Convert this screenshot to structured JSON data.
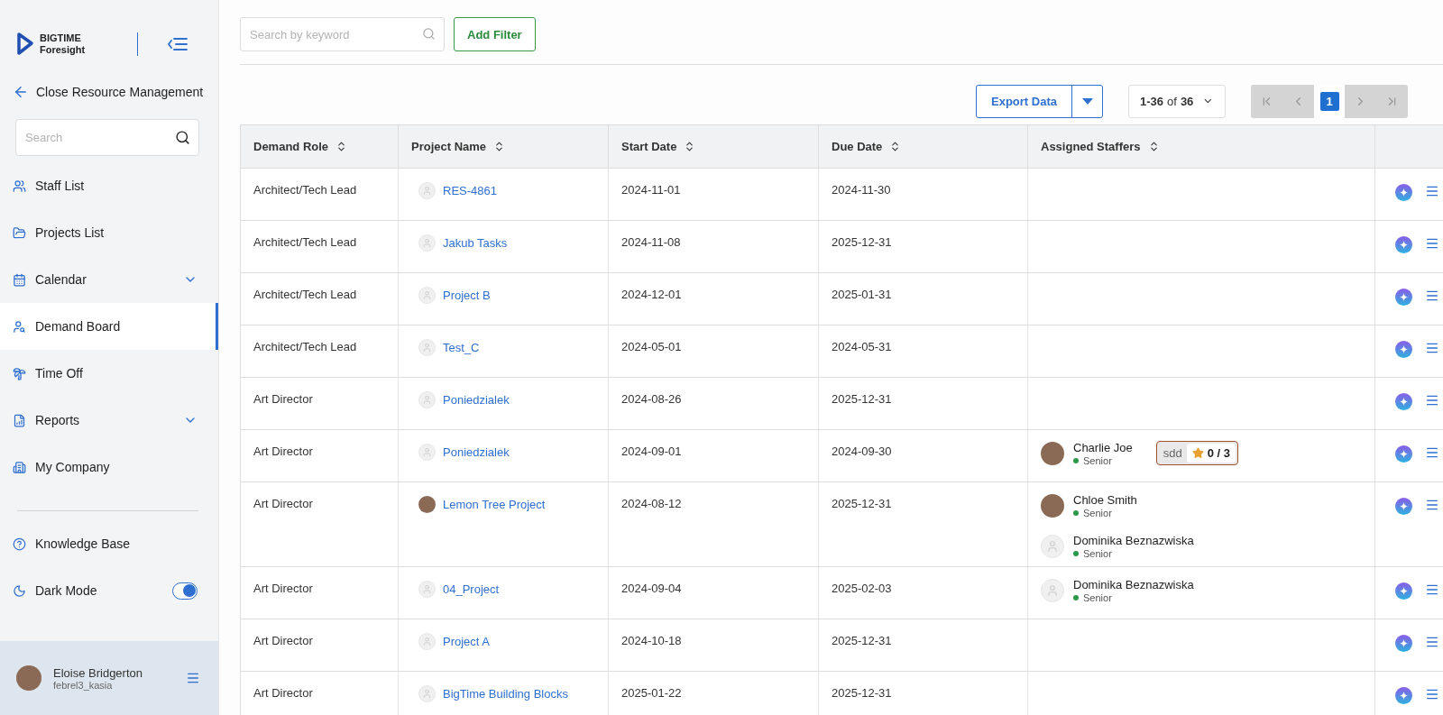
{
  "sidebar": {
    "logo": {
      "line1": "BIGTIME",
      "line2": "Foresight"
    },
    "back_link": "Close Resource Management",
    "search": {
      "placeholder": "Search"
    },
    "items": [
      {
        "label": "Staff List",
        "selected": false
      },
      {
        "label": "Projects List",
        "selected": false
      },
      {
        "label": "Calendar",
        "selected": false,
        "expandable": true
      },
      {
        "label": "Demand Board",
        "selected": true
      },
      {
        "label": "Time Off",
        "selected": false
      },
      {
        "label": "Reports",
        "selected": false,
        "expandable": true
      },
      {
        "label": "My Company",
        "selected": false
      }
    ],
    "help": "Knowledge Base",
    "dark_mode": {
      "label": "Dark Mode",
      "on": true
    },
    "user": {
      "name": "Eloise Bridgerton",
      "username": "febrel3_kasia"
    }
  },
  "toolbar": {
    "search": {
      "placeholder": "Search by keyword"
    },
    "filter_button": "Add Filter",
    "export_button": "Export Data",
    "range": {
      "from_to": "1-36",
      "of": "of",
      "total": "36"
    },
    "pages": [
      {
        "label": "1",
        "selected": true
      }
    ]
  },
  "table": {
    "columns": [
      "Demand Role",
      "Project Name",
      "Start Date",
      "Due Date",
      "Assigned Staffers"
    ],
    "rows": [
      {
        "role": "Architect/Tech Lead",
        "project": {
          "name": "RES-4861",
          "photo": false
        },
        "start": "2024-11-01",
        "due": "2024-11-30",
        "staffers": []
      },
      {
        "role": "Architect/Tech Lead",
        "project": {
          "name": "Jakub Tasks",
          "photo": false
        },
        "start": "2024-11-08",
        "due": "2025-12-31",
        "staffers": []
      },
      {
        "role": "Architect/Tech Lead",
        "project": {
          "name": "Project B",
          "photo": false
        },
        "start": "2024-12-01",
        "due": "2025-01-31",
        "staffers": []
      },
      {
        "role": "Architect/Tech Lead",
        "project": {
          "name": "Test_C",
          "photo": false
        },
        "start": "2024-05-01",
        "due": "2024-05-31",
        "staffers": []
      },
      {
        "role": "Art Director",
        "project": {
          "name": "Poniedzialek",
          "photo": false
        },
        "start": "2024-08-26",
        "due": "2025-12-31",
        "staffers": []
      },
      {
        "role": "Art Director",
        "project": {
          "name": "Poniedzialek",
          "photo": false
        },
        "start": "2024-09-01",
        "due": "2024-09-30",
        "staffers": [
          {
            "name": "Charlie Joe",
            "level": "Senior",
            "photo": true,
            "skill": {
              "label": "sdd",
              "rating": "0 / 3"
            }
          }
        ]
      },
      {
        "role": "Art Director",
        "project": {
          "name": "Lemon Tree Project",
          "photo": true
        },
        "start": "2024-08-12",
        "due": "2025-12-31",
        "staffers": [
          {
            "name": "Chloe Smith",
            "level": "Senior",
            "photo": true
          },
          {
            "name": "Dominika Beznazwiska",
            "level": "Senior",
            "photo": false
          }
        ]
      },
      {
        "role": "Art Director",
        "project": {
          "name": "04_Project",
          "photo": false
        },
        "start": "2024-09-04",
        "due": "2025-02-03",
        "staffers": [
          {
            "name": "Dominika Beznazwiska",
            "level": "Senior",
            "photo": false
          }
        ]
      },
      {
        "role": "Art Director",
        "project": {
          "name": "Project A",
          "photo": false
        },
        "start": "2024-10-18",
        "due": "2025-12-31",
        "staffers": []
      },
      {
        "role": "Art Director",
        "project": {
          "name": "BigTime Building Blocks",
          "photo": false
        },
        "start": "2025-01-22",
        "due": "2025-12-31",
        "staffers": []
      }
    ]
  }
}
